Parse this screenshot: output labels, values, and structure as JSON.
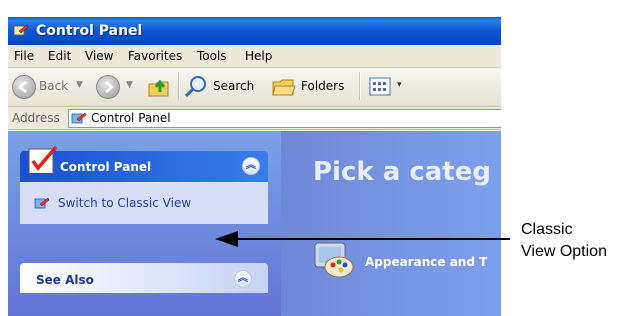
{
  "window": {
    "title": "Control Panel"
  },
  "menu": {
    "items": [
      "File",
      "Edit",
      "View",
      "Favorites",
      "Tools",
      "Help"
    ]
  },
  "toolbar": {
    "back_label": "Back",
    "search_label": "Search",
    "folders_label": "Folders"
  },
  "address": {
    "label": "Address",
    "value": "Control Panel"
  },
  "sidebar": {
    "panel_title": "Control Panel",
    "switch_link": "Switch to Classic View",
    "see_also_title": "See Also"
  },
  "main": {
    "heading": "Pick a categ",
    "category_label": "Appearance and T"
  },
  "annotation": {
    "line1": "Classic",
    "line2": "View Option"
  },
  "colors": {
    "title_bar": "#0b57d0",
    "sidebar_bg": "#7aa1e6",
    "main_bg": "#7da0ec",
    "link": "#1e3fa6"
  }
}
